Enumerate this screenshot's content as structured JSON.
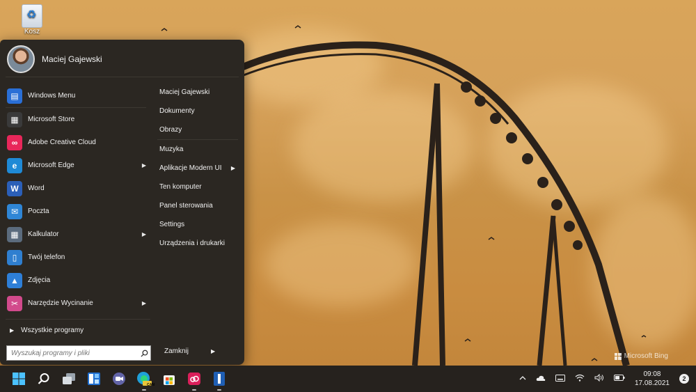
{
  "desktop": {
    "recycle_bin_label": "Kosz",
    "watermark": "Microsoft Bing"
  },
  "start_menu": {
    "user_name": "Maciej Gajewski",
    "left_items": [
      {
        "label": "Windows Menu",
        "icon": "windows-menu-icon",
        "color": "#2a6fd6",
        "arrow": false
      },
      {
        "label": "Microsoft Store",
        "icon": "store-icon",
        "color": "#3a3a3a",
        "arrow": false
      },
      {
        "label": "Adobe Creative Cloud",
        "icon": "creative-cloud-icon",
        "color": "#e8275a",
        "arrow": false
      },
      {
        "label": "Microsoft Edge",
        "icon": "edge-icon",
        "color": "#1f8ad6",
        "arrow": true
      },
      {
        "label": "Word",
        "icon": "word-icon",
        "color": "#2b5fb8",
        "arrow": false
      },
      {
        "label": "Poczta",
        "icon": "mail-icon",
        "color": "#2f86d6",
        "arrow": false
      },
      {
        "label": "Kalkulator",
        "icon": "calculator-icon",
        "color": "#5b6b7d",
        "arrow": true
      },
      {
        "label": "Twój telefon",
        "icon": "phone-icon",
        "color": "#2f7fd0",
        "arrow": false
      },
      {
        "label": "Zdjęcia",
        "icon": "photos-icon",
        "color": "#2e7fd8",
        "arrow": false
      },
      {
        "label": "Narzędzie Wycinanie",
        "icon": "snipping-icon",
        "color": "#d24a8c",
        "arrow": true
      }
    ],
    "all_programs": "Wszystkie programy",
    "search_placeholder": "Wyszukaj programy i pliki",
    "right_items": [
      {
        "label": "Maciej Gajewski",
        "arrow": false
      },
      {
        "label": "Dokumenty",
        "arrow": false
      },
      {
        "label": "Obrazy",
        "arrow": false
      },
      {
        "label": "Muzyka",
        "arrow": false
      },
      {
        "label": "Aplikacje Modern UI",
        "arrow": true
      },
      {
        "label": "Ten komputer",
        "arrow": false
      },
      {
        "label": "Panel sterowania",
        "arrow": false
      },
      {
        "label": "Settings",
        "arrow": false
      },
      {
        "label": "Urządzenia i drukarki",
        "arrow": false
      }
    ],
    "shutdown_label": "Zamknij"
  },
  "taskbar": {
    "apps": [
      "start-icon",
      "search-icon",
      "task-view-icon",
      "widgets-icon",
      "chat-icon",
      "edge-can-icon",
      "store-icon",
      "creative-cloud-icon",
      "open-shell-icon"
    ],
    "edge_badge": "CAN",
    "time": "09:08",
    "date": "17.08.2021",
    "notification_count": "2"
  }
}
